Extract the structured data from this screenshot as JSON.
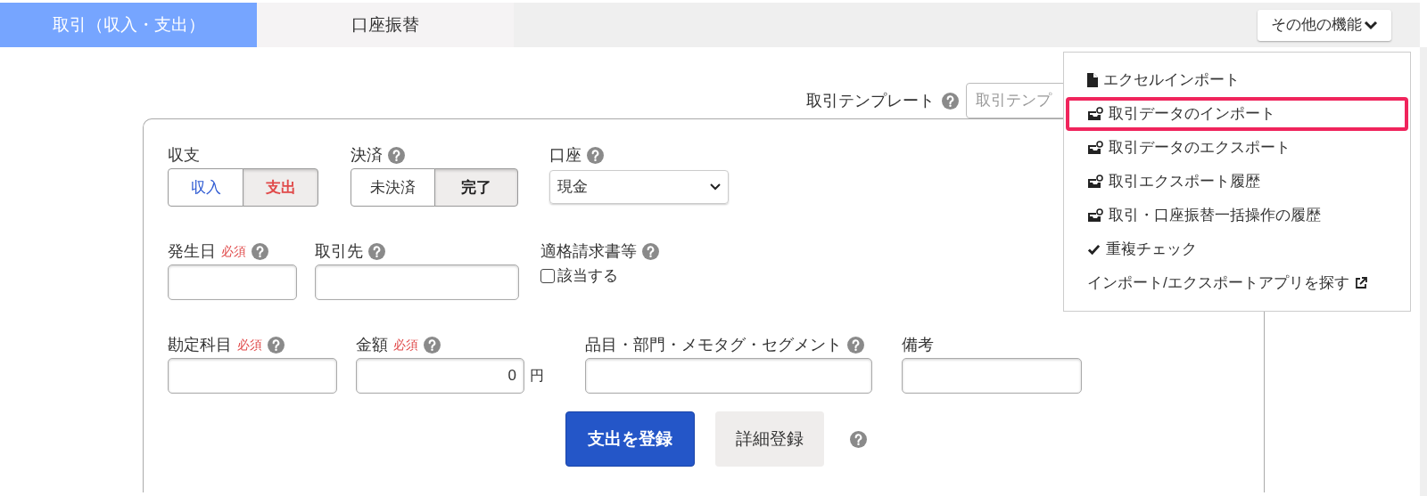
{
  "tabs": [
    {
      "label": "取引（収入・支出）",
      "selected": true
    },
    {
      "label": "口座振替",
      "selected": false
    }
  ],
  "more_button": {
    "label": "その他の機能",
    "expanded": true
  },
  "menu": [
    {
      "label": "エクセルインポート",
      "kind": "file",
      "highlighted": false,
      "external": false
    },
    {
      "label": "取引データのインポート",
      "kind": "inbox",
      "highlighted": true,
      "external": false
    },
    {
      "label": "取引データのエクスポート",
      "kind": "inbox",
      "highlighted": false,
      "external": false
    },
    {
      "label": "取引エクスポート履歴",
      "kind": "inbox",
      "highlighted": false,
      "external": false
    },
    {
      "label": "取引・口座振替一括操作の履歴",
      "kind": "inbox",
      "highlighted": false,
      "external": false
    },
    {
      "label": "重複チェック",
      "kind": "check",
      "highlighted": false,
      "external": false
    },
    {
      "label": "インポート/エクスポートアプリを探す",
      "kind": "link",
      "highlighted": false,
      "external": true
    }
  ],
  "template": {
    "label": "取引テンプレート",
    "help": true,
    "placeholder": "取引テンプ"
  },
  "rows": [
    [
      {
        "kind": "toggle",
        "label": "収支",
        "options": [
          {
            "label": "収入",
            "selected": false,
            "color": "#2f5bd3"
          },
          {
            "label": "支出",
            "selected": true,
            "color": "#e04a4a"
          }
        ]
      },
      {
        "kind": "toggle",
        "label": "決済",
        "help": true,
        "options": [
          {
            "label": "未決済",
            "selected": false,
            "color": "#333333"
          },
          {
            "label": "完了",
            "selected": true,
            "color": "#222222"
          }
        ]
      },
      {
        "kind": "select",
        "label": "口座",
        "help": true,
        "value": "現金"
      }
    ],
    [
      {
        "kind": "text",
        "label": "発生日",
        "required": "必須",
        "help": true
      },
      {
        "kind": "text",
        "label": "取引先",
        "help": true
      },
      {
        "kind": "checkbox",
        "label": "適格請求書等",
        "help": true,
        "option": "該当する",
        "checked": false
      }
    ],
    [
      {
        "kind": "text",
        "label": "勘定科目",
        "required": "必須",
        "help": true
      },
      {
        "kind": "text",
        "label": "金額",
        "required": "必須",
        "help": true,
        "value": "0",
        "suffix": "円"
      },
      {
        "kind": "text",
        "label": "品目・部門・メモタグ・セグメント",
        "help": true
      },
      {
        "kind": "text",
        "label": "備考"
      }
    ]
  ],
  "buttons": [
    {
      "label": "支出を登録",
      "kind": "primary"
    },
    {
      "label": "詳細登録",
      "kind": "secondary"
    }
  ],
  "buttons_help": true
}
